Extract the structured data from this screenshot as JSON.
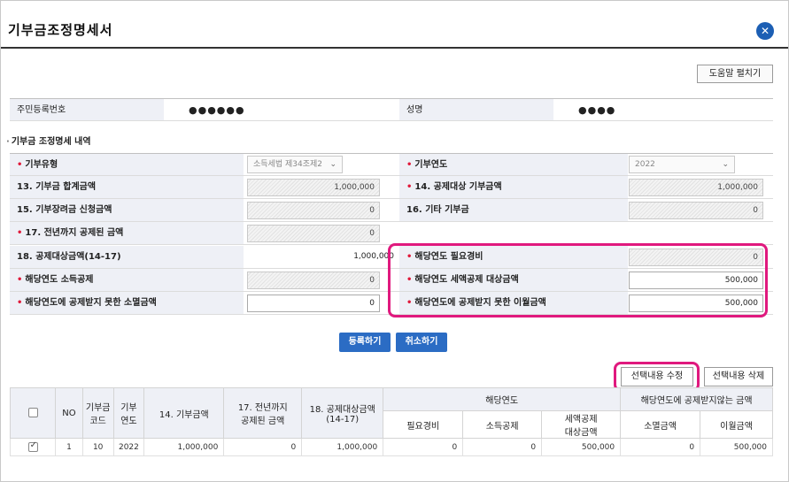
{
  "window": {
    "title": "기부금조정명세서",
    "close_icon": "close-icon"
  },
  "toolbar": {
    "help_label": "도움말 펼치기"
  },
  "person": {
    "rrn_label": "주민등록번호",
    "rrn_value": "●●●●●●",
    "name_label": "성명",
    "name_value": "●●●●"
  },
  "section": {
    "title": "기부금 조정명세 내역"
  },
  "form": {
    "donation_type_label": "기부유형",
    "donation_type_value": "소득세법 제34조제2",
    "donation_year_label": "기부연도",
    "donation_year_value": "2022",
    "total_amount_label": "13. 기부금 합계금액",
    "total_amount_value": "1,000,000",
    "deductible_label": "14. 공제대상 기부금액",
    "deductible_value": "1,000,000",
    "scholarship_label": "15. 기부장려금 신청금액",
    "scholarship_value": "0",
    "other_label": "16. 기타 기부금",
    "other_value": "0",
    "prev_deducted_label": "17. 전년까지 공제된 금액",
    "prev_deducted_value": "0",
    "target_amount_label": "18. 공제대상금액(14-17)",
    "target_amount_value": "1,000,000",
    "required_expense_label": "해당연도 필요경비",
    "required_expense_value": "0",
    "income_deduction_label": "해당연도 소득공제",
    "income_deduction_value": "0",
    "tax_credit_label": "해당연도 세액공제 대상금액",
    "tax_credit_value": "500,000",
    "extinct_label": "해당연도에 공제받지 못한 소멸금액",
    "extinct_value": "0",
    "carryover_label": "해당연도에 공제받지 못한 이월금액",
    "carryover_value": "500,000"
  },
  "actions": {
    "register_label": "등록하기",
    "cancel_label": "취소하기",
    "edit_selected_label": "선택내용 수정",
    "delete_selected_label": "선택내용 삭제"
  },
  "table": {
    "headers": {
      "no": "NO",
      "code": "기부금\n코드",
      "year": "기부\n연도",
      "amount14": "14. 기부금액",
      "deducted17": "17. 전년까지\n공제된 금액",
      "target18": "18. 공제대상금액\n(14-17)",
      "current_year": "해당연도",
      "not_deducted": "해당연도에 공제받지않는 금액",
      "required_expense": "필요경비",
      "income_deduction": "소득공제",
      "tax_credit": "세액공제\n대상금액",
      "extinct": "소멸금액",
      "carryover": "이월금액"
    },
    "rows": [
      {
        "checked": true,
        "no": "1",
        "code": "10",
        "year": "2022",
        "amount14": "1,000,000",
        "deducted17": "0",
        "target18": "1,000,000",
        "required_expense": "0",
        "income_deduction": "0",
        "tax_credit": "500,000",
        "extinct": "0",
        "carryover": "500,000"
      }
    ]
  },
  "colors": {
    "accent": "#2b6cc4",
    "highlight": "#e0197e",
    "label_bg": "#eef0f6",
    "required_star": "#e0193a"
  }
}
